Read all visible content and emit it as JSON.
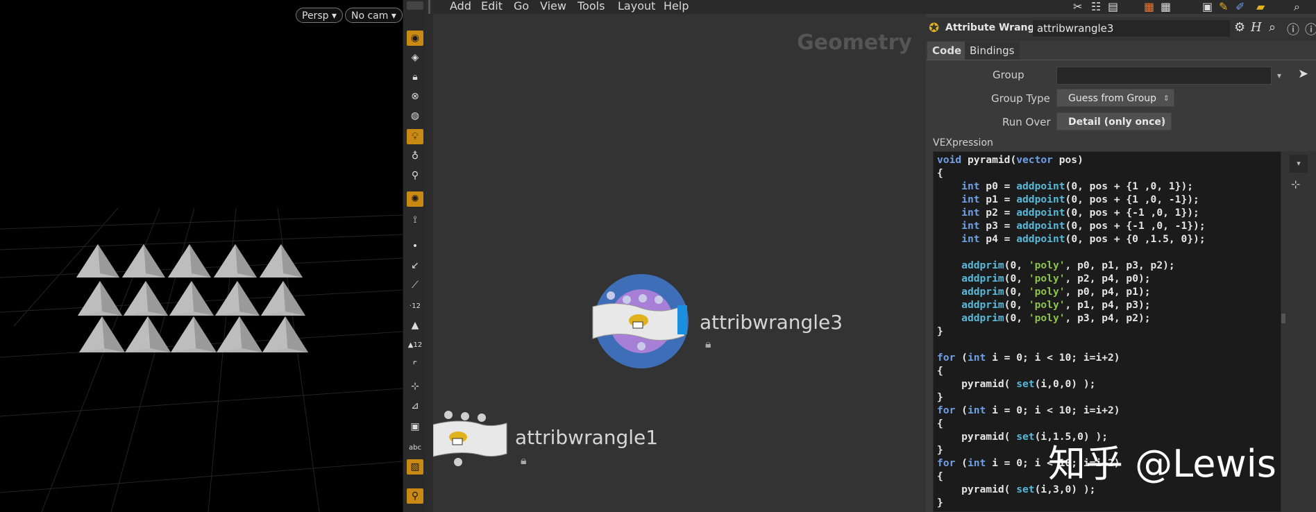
{
  "viewport": {
    "camera_persp": "Persp",
    "camera_no_cam": "No cam"
  },
  "network": {
    "menu": [
      "Add",
      "Edit",
      "Go",
      "View",
      "Tools",
      "Layout",
      "Help"
    ],
    "title": "Geometry",
    "nodes": [
      {
        "name": "attribwrangle3"
      },
      {
        "name": "attribwrangle1"
      }
    ]
  },
  "param": {
    "node_type": "Attribute Wrangle",
    "node_name": "attribwrangle3",
    "tabs": [
      "Code",
      "Bindings"
    ],
    "group_label": "Group",
    "group_value": "",
    "group_type_label": "Group Type",
    "group_type_value": "Guess from Group",
    "run_over_label": "Run Over",
    "run_over_value": "Detail (only once)",
    "vexpression_label": "VEXpression",
    "code_lines": [
      "void pyramid(vector pos)",
      "{",
      "    int p0 = addpoint(0, pos + {1 ,0, 1});",
      "    int p1 = addpoint(0, pos + {1 ,0, -1});",
      "    int p2 = addpoint(0, pos + {-1 ,0, 1});",
      "    int p3 = addpoint(0, pos + {-1 ,0, -1});",
      "    int p4 = addpoint(0, pos + {0 ,1.5, 0});",
      "",
      "    addprim(0, 'poly', p0, p1, p3, p2);",
      "    addprim(0, 'poly', p2, p4, p0);",
      "    addprim(0, 'poly', p0, p4, p1);",
      "    addprim(0, 'poly', p1, p4, p3);",
      "    addprim(0, 'poly', p3, p4, p2);",
      "}",
      "",
      "for (int i = 0; i < 10; i=i+2)",
      "{",
      "    pyramid( set(i,0,0) );",
      "}",
      "for (int i = 0; i < 10; i=i+2)",
      "{",
      "    pyramid( set(i,1.5,0) );",
      "}",
      "for (int i = 0; i < 10; i=i+2)",
      "{",
      "    pyramid( set(i,3,0) );",
      "}"
    ]
  },
  "watermark": "知乎 @Lewis",
  "colors": {
    "shelf_active": "#c98a14",
    "node_ring": "#3e6eb8",
    "node_inner": "#a77fd6",
    "keyword": "#6ea0e6",
    "function": "#57b8d8",
    "string": "#8cc24a"
  }
}
